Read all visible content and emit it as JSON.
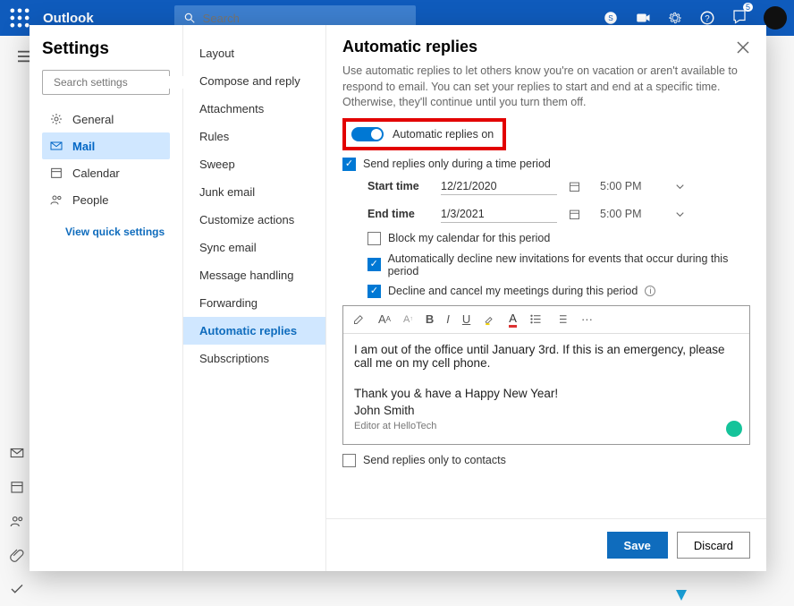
{
  "appbar": {
    "brand": "Outlook",
    "search_placeholder": "Search",
    "notification_count": "5"
  },
  "settings": {
    "title": "Settings",
    "search_placeholder": "Search settings",
    "nav": {
      "general": "General",
      "mail": "Mail",
      "calendar": "Calendar",
      "people": "People",
      "quick": "View quick settings"
    }
  },
  "subnav": {
    "layout": "Layout",
    "compose": "Compose and reply",
    "attachments": "Attachments",
    "rules": "Rules",
    "sweep": "Sweep",
    "junk": "Junk email",
    "customize": "Customize actions",
    "sync": "Sync email",
    "msghandling": "Message handling",
    "forwarding": "Forwarding",
    "autoreply": "Automatic replies",
    "subscriptions": "Subscriptions"
  },
  "panel": {
    "title": "Automatic replies",
    "desc": "Use automatic replies to let others know you're on vacation or aren't available to respond to email. You can set your replies to start and end at a specific time. Otherwise, they'll continue until you turn them off.",
    "toggle_label": "Automatic replies on",
    "time_period_chk": "Send replies only during a time period",
    "start_label": "Start time",
    "end_label": "End time",
    "start_date": "12/21/2020",
    "end_date": "1/3/2021",
    "start_time": "5:00 PM",
    "end_time": "5:00 PM",
    "block_cal": "Block my calendar for this period",
    "decline_new": "Automatically decline new invitations for events that occur during this period",
    "decline_cancel": "Decline and cancel my meetings during this period",
    "contacts_only": "Send replies only to contacts",
    "message_l1": "I am out of the office until January 3rd. If this is an emergency, please call me on my cell phone.",
    "message_l2": "Thank you & have a Happy New Year!",
    "message_l3": "John Smith",
    "message_l4": "Editor at HelloTech",
    "save": "Save",
    "discard": "Discard"
  },
  "toolbar": {
    "bold": "B",
    "italic": "I",
    "underline": "U",
    "fontup": "A",
    "fontdown": "A",
    "color": "A",
    "more": "···"
  }
}
